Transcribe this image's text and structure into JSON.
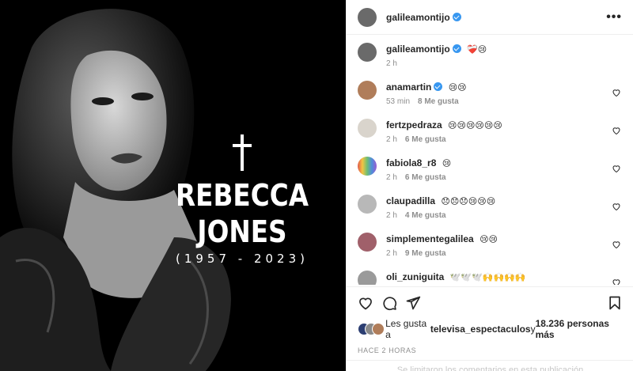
{
  "post": {
    "author": "galileamontijo",
    "author_verified": true,
    "more_label": "•••"
  },
  "media": {
    "cross_symbol": "†",
    "name": "REBECCA JONES",
    "years": "(1957 - 2023)"
  },
  "caption": {
    "user": "galileamontijo",
    "text": "❤️‍🩹😢",
    "time": "2 h"
  },
  "comments": [
    {
      "user": "anamartin",
      "verified": true,
      "text": "😢😢",
      "time": "53 min",
      "likes": "8 Me gusta",
      "avatar_color": "#b07d5a"
    },
    {
      "user": "fertzpedraza",
      "verified": false,
      "text": "😢😢😢😢😢😢",
      "time": "2 h",
      "likes": "6 Me gusta",
      "avatar_color": "#d9d4cc"
    },
    {
      "user": "fabiola8_r8",
      "verified": false,
      "text": "😢",
      "time": "2 h",
      "likes": "6 Me gusta",
      "avatar_color": "#6fbf73"
    },
    {
      "user": "claupadilla",
      "verified": false,
      "text": "😞😞😞😢😢😢",
      "time": "2 h",
      "likes": "4 Me gusta",
      "avatar_color": "#b8b8b8"
    },
    {
      "user": "simplementegalilea",
      "verified": false,
      "text": "😢😢",
      "time": "2 h",
      "likes": "9 Me gusta",
      "avatar_color": "#a0606a"
    },
    {
      "user": "oli_zuniguita",
      "verified": false,
      "text": "🕊️🕊️🕊️🙌🙌🙌🙌",
      "time": "",
      "likes": "",
      "avatar_color": "#9a9a9a"
    }
  ],
  "likes_line": {
    "prefix": "Les gusta a ",
    "user": "televisa_espectaculos",
    "middle": " y ",
    "count": "18.236 personas más"
  },
  "time_ago": "HACE 2 HORAS",
  "comments_notice": "Se limitaron los comentarios en esta publicación",
  "colors": {
    "verified": "#3897f0",
    "secondary_text": "#8e8e8e",
    "border": "#efefef"
  }
}
